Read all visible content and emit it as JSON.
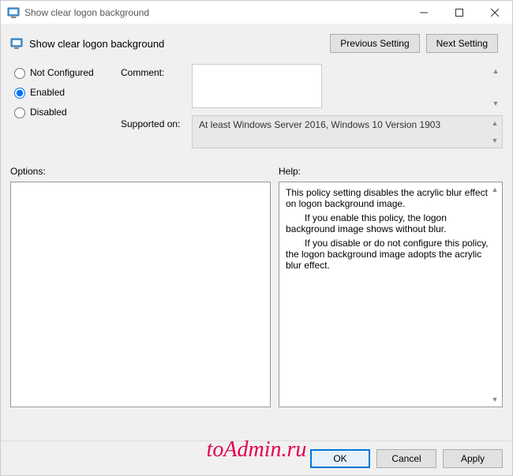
{
  "window": {
    "title": "Show clear logon background"
  },
  "header": {
    "policyName": "Show clear logon background",
    "prevBtn": "Previous Setting",
    "nextBtn": "Next Setting"
  },
  "radios": {
    "notConfigured": "Not Configured",
    "enabled": "Enabled",
    "disabled": "Disabled",
    "selected": "enabled"
  },
  "fields": {
    "commentLabel": "Comment:",
    "commentValue": "",
    "supportedLabel": "Supported on:",
    "supportedValue": "At least Windows Server 2016, Windows 10 Version 1903"
  },
  "lower": {
    "optionsLabel": "Options:",
    "helpLabel": "Help:",
    "helpText": {
      "p1": "This policy setting disables the acrylic blur effect on logon background image.",
      "p2": "If you enable this policy, the logon background image shows without blur.",
      "p3": "If you disable or do not configure this policy, the logon background image adopts the acrylic blur effect."
    }
  },
  "footer": {
    "ok": "OK",
    "cancel": "Cancel",
    "apply": "Apply"
  },
  "watermark": "toAdmin.ru"
}
